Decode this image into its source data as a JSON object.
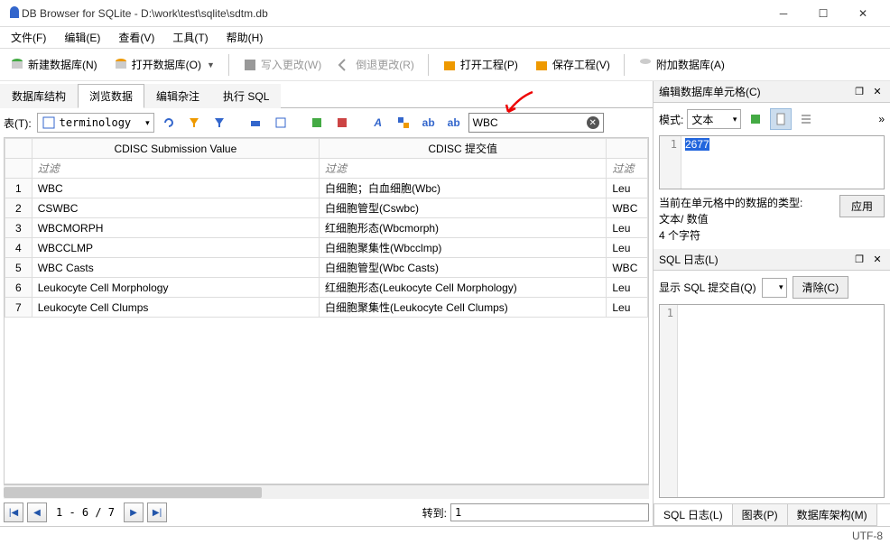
{
  "window": {
    "title": "DB Browser for SQLite - D:\\work\\test\\sqlite\\sdtm.db"
  },
  "menu": {
    "file": "文件(F)",
    "edit": "编辑(E)",
    "view": "查看(V)",
    "tools": "工具(T)",
    "help": "帮助(H)"
  },
  "toolbar": {
    "new_db": "新建数据库(N)",
    "open_db": "打开数据库(O)",
    "write_changes": "写入更改(W)",
    "revert_changes": "倒退更改(R)",
    "open_project": "打开工程(P)",
    "save_project": "保存工程(V)",
    "attach_db": "附加数据库(A)"
  },
  "maintabs": {
    "structure": "数据库结构",
    "browse": "浏览数据",
    "pragmas": "编辑杂注",
    "sql": "执行 SQL"
  },
  "browse": {
    "table_label": "表(T):",
    "table_name": "terminology",
    "search_value": "WBC",
    "filter_placeholder": "过滤",
    "columns": {
      "c1": "CDISC Submission Value",
      "c2": "CDISC 提交值",
      "c3": ""
    },
    "rows": [
      {
        "n": "1",
        "a": "WBC",
        "b": "白细胞；白血细胞(Wbc)",
        "c": "Leu"
      },
      {
        "n": "2",
        "a": "CSWBC",
        "b": "白细胞管型(Cswbc)",
        "c": "WBC"
      },
      {
        "n": "3",
        "a": "WBCMORPH",
        "b": "红细胞形态(Wbcmorph)",
        "c": "Leu"
      },
      {
        "n": "4",
        "a": "WBCCLMP",
        "b": "白细胞聚集性(Wbcclmp)",
        "c": "Leu"
      },
      {
        "n": "5",
        "a": "WBC Casts",
        "b": "白细胞管型(Wbc Casts)",
        "c": "WBC"
      },
      {
        "n": "6",
        "a": "Leukocyte Cell Morphology",
        "b": "红细胞形态(Leukocyte Cell Morphology)",
        "c": "Leu"
      },
      {
        "n": "7",
        "a": "Leukocyte Cell Clumps",
        "b": "白细胞聚集性(Leukocyte Cell Clumps)",
        "c": "Leu"
      }
    ],
    "nav": {
      "range": "1 - 6 / 7",
      "goto_label": "转到:",
      "goto_value": "1"
    }
  },
  "cellpanel": {
    "title": "编辑数据库单元格(C)",
    "mode_label": "模式:",
    "mode_value": "文本",
    "cell_value": "2677",
    "type_label": "当前在单元格中的数据的类型:",
    "type_value": "文本/ 数值",
    "char_count": "4 个字符",
    "apply": "应用"
  },
  "sqlpanel": {
    "title": "SQL 日志(L)",
    "show_label": "显示 SQL 提交自(Q)",
    "clear": "清除(C)",
    "tabs": {
      "log": "SQL 日志(L)",
      "plot": "图表(P)",
      "schema": "数据库架构(M)"
    }
  },
  "status": {
    "encoding": "UTF-8"
  }
}
